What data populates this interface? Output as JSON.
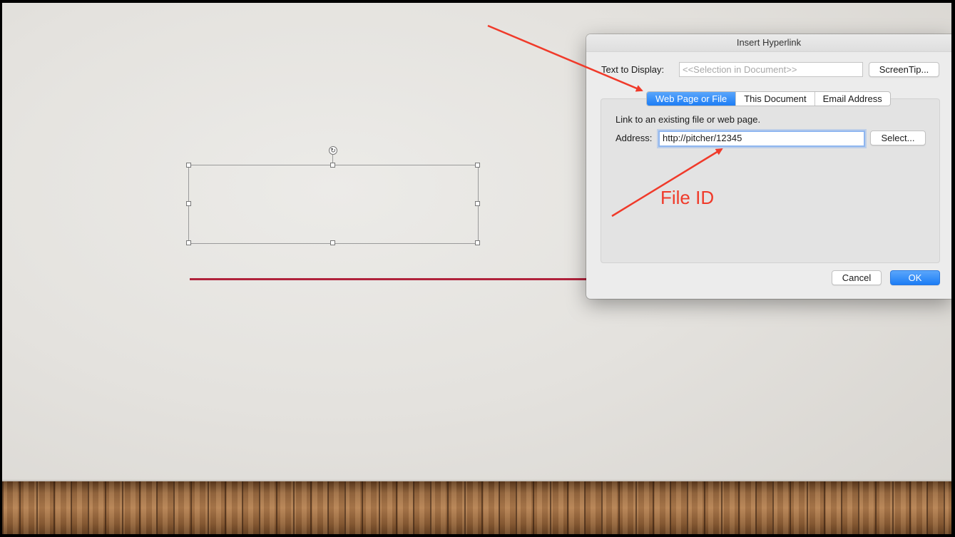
{
  "dialog": {
    "title": "Insert Hyperlink",
    "text_to_display_label": "Text to Display:",
    "text_to_display_placeholder": "<<Selection in Document>>",
    "screentip_button": "ScreenTip...",
    "tabs": [
      {
        "label": "Web Page or File",
        "active": true
      },
      {
        "label": "This Document",
        "active": false
      },
      {
        "label": "Email Address",
        "active": false
      }
    ],
    "panel_description": "Link to an existing file or web page.",
    "address_label": "Address:",
    "address_value": "http://pitcher/12345",
    "select_button": "Select...",
    "cancel_button": "Cancel",
    "ok_button": "OK"
  },
  "annotation": {
    "file_id_label": "File ID",
    "color": "#f03a2a"
  },
  "slide": {
    "accent_line_color": "#b0223b"
  },
  "icons": {
    "rotate_handle": "rotate-icon"
  }
}
